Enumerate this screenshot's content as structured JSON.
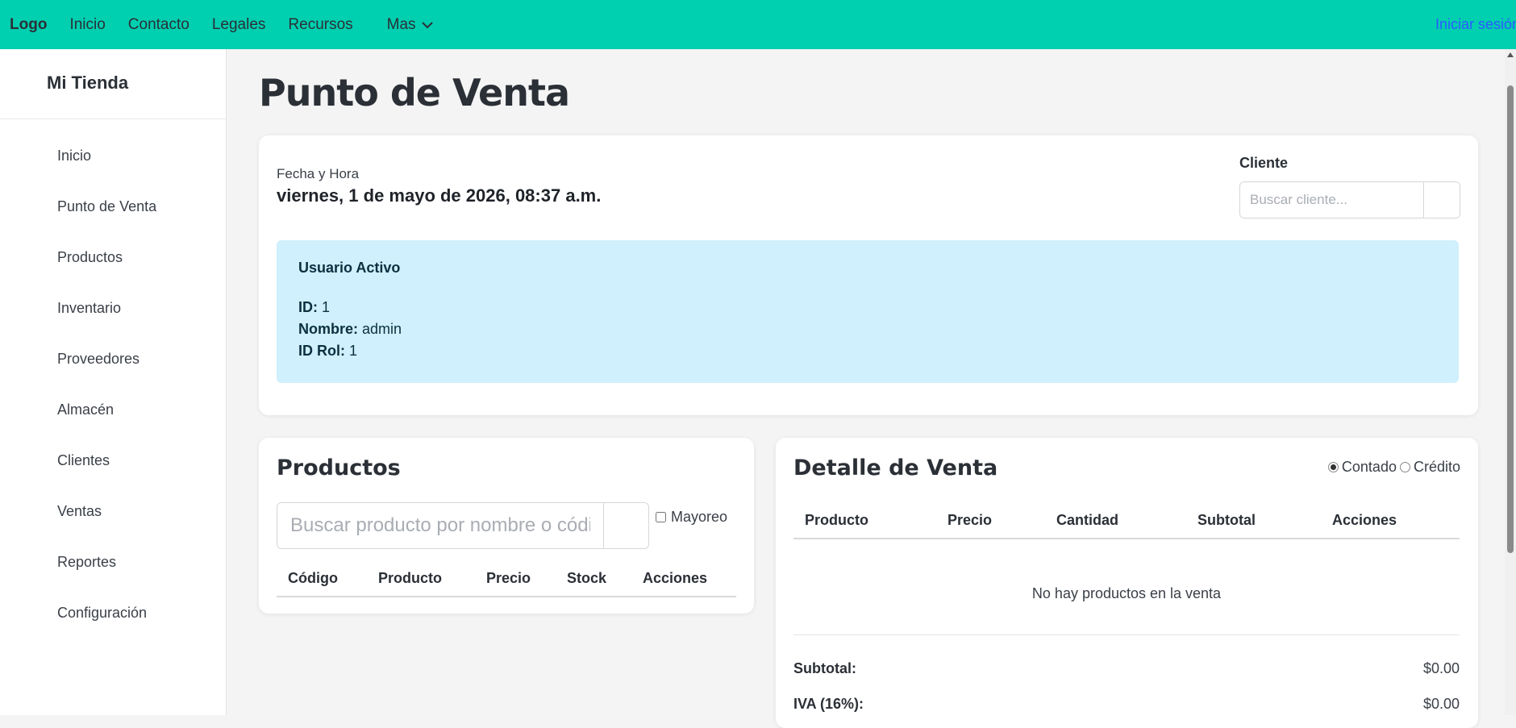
{
  "topnav": {
    "logo": "Logo",
    "links": [
      "Inicio",
      "Contacto",
      "Legales",
      "Recursos"
    ],
    "more": "Mas",
    "login": "Iniciar sesión"
  },
  "sidebar": {
    "brand": "Mi Tienda",
    "items": [
      {
        "label": "Inicio"
      },
      {
        "label": "Punto de Venta"
      },
      {
        "label": "Productos"
      },
      {
        "label": "Inventario"
      },
      {
        "label": "Proveedores"
      },
      {
        "label": "Almacén"
      },
      {
        "label": "Clientes"
      },
      {
        "label": "Ventas"
      },
      {
        "label": "Reportes"
      },
      {
        "label": "Configuración"
      }
    ]
  },
  "page": {
    "title": "Punto de Venta"
  },
  "info": {
    "datetime_label": "Fecha y Hora",
    "datetime_value": "viernes, 1 de mayo de 2026, 08:37 a.m.",
    "cliente_label": "Cliente",
    "cliente_placeholder": "Buscar cliente..."
  },
  "user": {
    "title": "Usuario Activo",
    "id_label": "ID:",
    "id_value": "1",
    "name_label": "Nombre:",
    "name_value": "admin",
    "role_label": "ID Rol:",
    "role_value": "1"
  },
  "products": {
    "title": "Productos",
    "search_placeholder": "Buscar producto por nombre o código",
    "mayoreo_label": "Mayoreo",
    "columns": [
      "Código",
      "Producto",
      "Precio",
      "Stock",
      "Acciones"
    ]
  },
  "detail": {
    "title": "Detalle de Venta",
    "payment_options": [
      "Contado",
      "Crédito"
    ],
    "selected_payment": "Contado",
    "columns": [
      "Producto",
      "Precio",
      "Cantidad",
      "Subtotal",
      "Acciones"
    ],
    "empty_text": "No hay productos en la venta",
    "subtotal_label": "Subtotal:",
    "subtotal_value": "$0.00",
    "iva_label": "IVA (16%):",
    "iva_value": "$0.00"
  },
  "colors": {
    "navbar": "#00cfb0",
    "user_box": "#cff0fc",
    "login_link": "#2d5bff"
  }
}
